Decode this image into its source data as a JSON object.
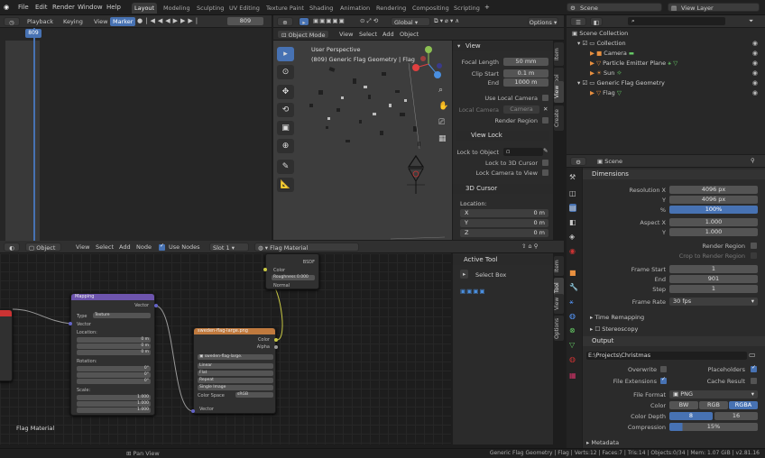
{
  "menus": [
    "File",
    "Edit",
    "Render",
    "Window",
    "Help"
  ],
  "workspaces": [
    "Layout",
    "Modeling",
    "Sculpting",
    "UV Editing",
    "Texture Paint",
    "Shading",
    "Animation",
    "Rendering",
    "Compositing",
    "Scripting"
  ],
  "scene_name": "Scene",
  "view_layer": "View Layer",
  "timeline": {
    "playback": "Playback",
    "keying": "Keying",
    "view": "View",
    "marker": "Marker",
    "frame": "809",
    "cursor_frame": "809"
  },
  "viewport": {
    "mode": "Object Mode",
    "menus": [
      "View",
      "Select",
      "Add",
      "Object"
    ],
    "orientation": "Global",
    "options": "Options",
    "overlay_title": "User Perspective",
    "overlay_sub": "(809) Generic Flag Geometry | Flag"
  },
  "n_panel": {
    "view_title": "View",
    "focal_label": "Focal Length",
    "focal": "50 mm",
    "clip_start_label": "Clip Start",
    "clip_start": "0.1 m",
    "end_label": "End",
    "clip_end": "1000 m",
    "use_local_camera": "Use Local Camera",
    "local_camera": "Local Camera",
    "camera": "Camera",
    "render_region": "Render Region",
    "view_lock": "View Lock",
    "lock_to_object": "Lock to Object",
    "lock_3d_cursor": "Lock to 3D Cursor",
    "lock_camera": "Lock Camera to View",
    "cursor_title": "3D Cursor",
    "location": "Location:",
    "x": "X",
    "y": "Y",
    "z": "Z",
    "x_val": "0 m",
    "y_val": "0 m",
    "z_val": "0 m",
    "tabs": [
      "Item",
      "Tool",
      "View",
      "Create"
    ]
  },
  "outliner": {
    "collection_root": "Scene Collection",
    "items": [
      {
        "name": "Collection",
        "depth": 1
      },
      {
        "name": "Camera",
        "depth": 2
      },
      {
        "name": "Particle Emitter Plane",
        "depth": 2
      },
      {
        "name": "Sun",
        "depth": 2
      },
      {
        "name": "Generic Flag Geometry",
        "depth": 1
      },
      {
        "name": "Flag",
        "depth": 2
      }
    ]
  },
  "properties": {
    "scene": "Scene",
    "dimensions": "Dimensions",
    "res_x_label": "Resolution X",
    "res_x": "4096 px",
    "res_y_label": "Y",
    "res_y": "4096 px",
    "pct_label": "%",
    "pct": "100%",
    "aspect_x_label": "Aspect X",
    "aspect_x": "1.000",
    "aspect_y_label": "Y",
    "aspect_y": "1.000",
    "render_region": "Render Region",
    "crop": "Crop to Render Region",
    "frame_start_label": "Frame Start",
    "frame_start": "1",
    "end_label": "End",
    "frame_end": "901",
    "step_label": "Step",
    "step": "1",
    "frame_rate_label": "Frame Rate",
    "frame_rate": "30 fps",
    "time_remapping": "Time Remapping",
    "stereoscopy": "Stereoscopy",
    "output": "Output",
    "path": "E:\\Projects\\Christmas Baubles...gs4kV2Sweden\\SwedishFlags_",
    "overwrite": "Overwrite",
    "placeholders": "Placeholders",
    "file_ext": "File Extensions",
    "cache_result": "Cache Result",
    "file_format_label": "File Format",
    "file_format": "PNG",
    "color_label": "Color",
    "bw": "BW",
    "rgb": "RGB",
    "rgba": "RGBA",
    "depth_label": "Color Depth",
    "depth8": "8",
    "depth16": "16",
    "compression_label": "Compression",
    "compression": "15%",
    "metadata": "Metadata"
  },
  "node_editor": {
    "editor": "Object",
    "menus": [
      "View",
      "Select",
      "Add",
      "Node"
    ],
    "use_nodes": "Use Nodes",
    "slot": "Slot 1",
    "material": "Flag Material",
    "footer_label": "Flag Material",
    "active_tool": "Active Tool",
    "select_box": "Select Box",
    "tabs": [
      "Item",
      "Tool",
      "View",
      "Options"
    ],
    "bsdf_label": "BSDF",
    "bsdf_color": "Color",
    "roughness": "Roughness",
    "roughness_val": "0.000",
    "normal": "Normal",
    "mapping": "Mapping",
    "vector_out": "Vector",
    "type_label": "Type",
    "type_val": "Texture",
    "vector_in": "Vector",
    "location": "Location:",
    "rotation": "Rotation:",
    "scale": "Scale:",
    "loc_vals": [
      "0 m",
      "0 m",
      "0 m"
    ],
    "rot_vals": [
      "0°",
      "0°",
      "0°"
    ],
    "scale_vals": [
      "1.000",
      "1.000",
      "1.000"
    ],
    "img_tex": "sweden-flag-large.png",
    "img_file": "sweden-flag-large.",
    "col_out": "Color",
    "alpha_out": "Alpha",
    "linear": "Linear",
    "flat": "Flat",
    "repeat": "Repeat",
    "single": "Single Image",
    "cs_label": "Color Space",
    "cs_val": "sRGB",
    "vec_in2": "Vector"
  },
  "status": {
    "pan": "Pan View",
    "info": "Generic Flag Geometry | Flag | Verts:12 | Faces:7 | Tris:14 | Objects:0/34 | Mem: 1.07 GiB | v2.81.16"
  }
}
